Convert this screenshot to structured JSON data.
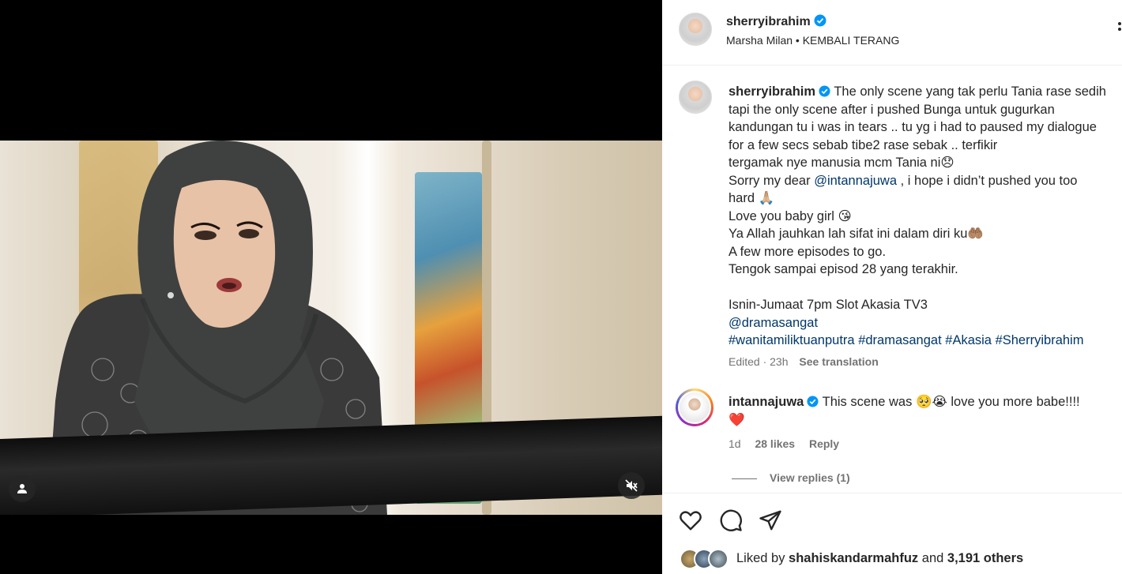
{
  "post": {
    "username": "sherryibrahim",
    "audio_artist": "Marsha Milan",
    "audio_separator": "•",
    "audio_title": "KEMBALI TERANG"
  },
  "caption": {
    "username": "sherryibrahim",
    "line1": "The only scene yang tak perlu Tania rase sedih",
    "line2": "tapi the only scene after i pushed Bunga untuk gugurkan",
    "line3": "kandungan tu i was in tears .. tu yg i had to paused my dialogue",
    "line4": "for a few secs sebab tibe2 rase sebak .. terfikir",
    "line5": "tergamak nye manusia mcm Tania ni😞",
    "line6_prefix": "Sorry my dear ",
    "line6_mention": "@intannajuwa",
    "line6_suffix": " , i hope i didn’t pushed you too",
    "line7": "hard 🙏🏼",
    "line8": "Love you baby girl 😘",
    "line9": "Ya Allah jauhkan lah sifat ini dalam diri ku🤲🏽",
    "line10": "A few more episodes to go.",
    "line11": "Tengok sampai episod 28 yang terakhir.",
    "line12": "Isnin-Jumaat 7pm Slot Akasia TV3",
    "mention2": "@dramasangat",
    "hashtags": [
      "#wanitamiliktuanputra",
      "#dramasangat",
      "#Akasia",
      "#Sherryibrahim"
    ],
    "edited": "Edited · 23h",
    "see_translation": "See translation"
  },
  "comment": {
    "username": "intannajuwa",
    "text_prefix": "This scene was ",
    "emojis": "🥺😭",
    "text_suffix": " love you more babe!!!!",
    "heart": "❤️",
    "time": "1d",
    "likes": "28 likes",
    "reply": "Reply",
    "view_replies": "View replies (1)"
  },
  "likes": {
    "prefix": "Liked by ",
    "user": "shahiskandarmahfuz",
    "middle": " and ",
    "others": "3,191 others"
  },
  "icons": {
    "verified": "verified-badge-icon",
    "like": "heart-icon",
    "comment": "comment-bubble-icon",
    "share": "paper-plane-icon",
    "user_tag": "user-tag-icon",
    "mute": "speaker-muted-icon"
  },
  "colors": {
    "verified_blue": "#0095f6",
    "link": "#00376b",
    "muted_text": "#737373",
    "heart_red": "#ed4956"
  }
}
